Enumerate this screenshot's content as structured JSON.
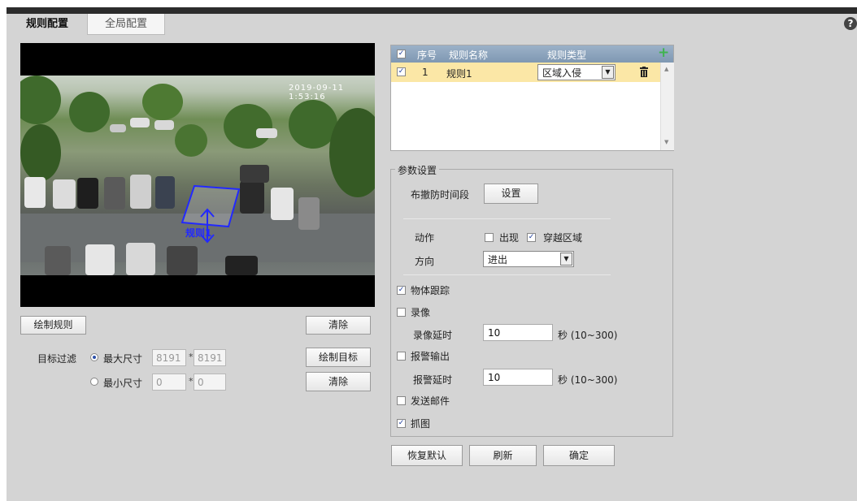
{
  "tabs": {
    "active": "规则配置",
    "inactive": "全局配置"
  },
  "help_icon": "?",
  "video": {
    "osd_text": "2019-09-11 1:53:16",
    "zone_label": "规则1"
  },
  "left": {
    "draw_rule": "绘制规则",
    "clear": "清除",
    "target_filter": "目标过滤",
    "max_size": "最大尺寸",
    "min_size": "最小尺寸",
    "max_w": "8191",
    "max_h": "8191",
    "min_w": "0",
    "min_h": "0",
    "star": "*",
    "draw_target": "绘制目标",
    "clear2": "清除"
  },
  "rules_table": {
    "headers": {
      "index": "序号",
      "name": "规则名称",
      "type": "规则类型"
    },
    "add_icon": "+",
    "rows": [
      {
        "index": "1",
        "name": "规则1",
        "type": "区域入侵",
        "checked": true
      }
    ]
  },
  "params": {
    "legend": "参数设置",
    "schedule_label": "布撤防时间段",
    "schedule_button": "设置",
    "action_label": "动作",
    "action_appear": "出现",
    "action_cross": "穿越区域",
    "direction_label": "方向",
    "direction_value": "进出",
    "object_tracking": "物体跟踪",
    "record": "录像",
    "record_delay_label": "录像延时",
    "record_delay_value": "10",
    "record_delay_unit": "秒 (10~300)",
    "alarm_out": "报警输出",
    "alarm_delay_label": "报警延时",
    "alarm_delay_value": "10",
    "alarm_delay_unit": "秒 (10~300)",
    "send_email": "发送邮件",
    "snapshot": "抓图"
  },
  "footer": {
    "restore": "恢复默认",
    "refresh": "刷新",
    "ok": "确定"
  },
  "check_mark": "✓",
  "colors": {
    "header": "#8aa3bd",
    "selected_row": "#fbe7a6",
    "zone": "#2229ff"
  }
}
